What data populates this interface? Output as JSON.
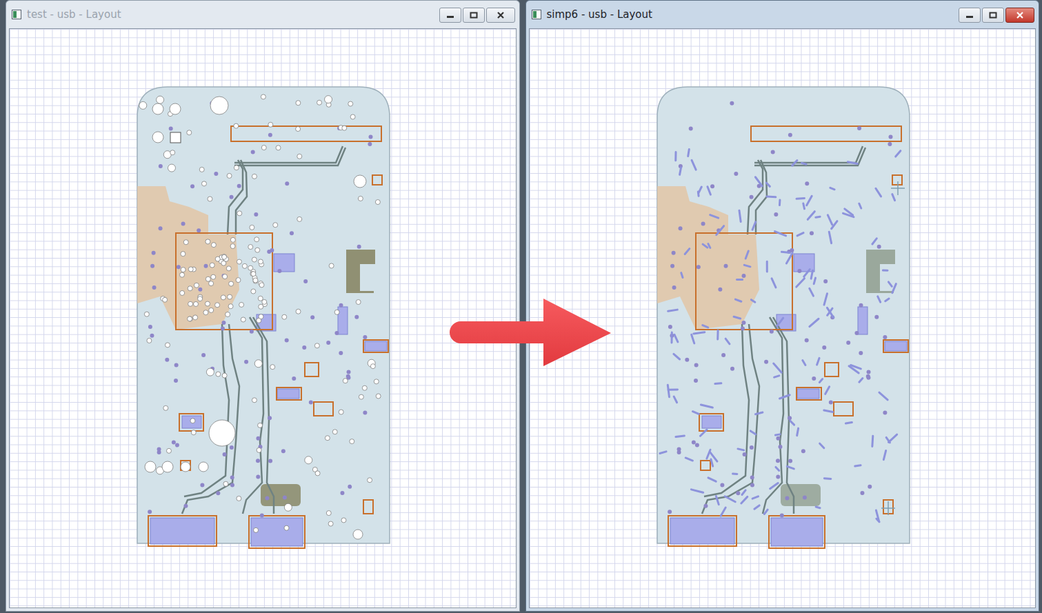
{
  "windows": [
    {
      "title": "test - usb - Layout",
      "active": false,
      "drill_holes_shown": true
    },
    {
      "title": "simp6 - usb - Layout",
      "active": true,
      "drill_holes_shown": false
    }
  ]
}
